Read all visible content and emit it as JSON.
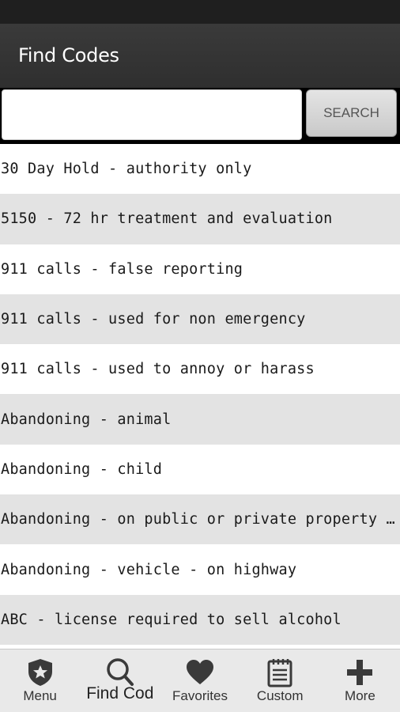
{
  "header": {
    "title": "Find Codes"
  },
  "search": {
    "placeholder": "",
    "value": "",
    "button_label": "SEARCH"
  },
  "results": [
    "30 Day Hold - authority only",
    "5150 - 72 hr treatment and evaluation",
    "911 calls - false reporting",
    "911 calls - used for non emergency",
    "911 calls - used to annoy or harass",
    "Abandoning - animal",
    "Abandoning - child",
    "Abandoning - on public or private property with...",
    "Abandoning - vehicle - on highway",
    "ABC - license required to sell alcohol"
  ],
  "nav": {
    "items": [
      {
        "label": "Menu",
        "icon": "badge-icon"
      },
      {
        "label": "Find Cod",
        "icon": "search-icon"
      },
      {
        "label": "Favorites",
        "icon": "heart-icon"
      },
      {
        "label": "Custom",
        "icon": "notepad-icon"
      },
      {
        "label": "More",
        "icon": "plus-icon"
      }
    ]
  }
}
